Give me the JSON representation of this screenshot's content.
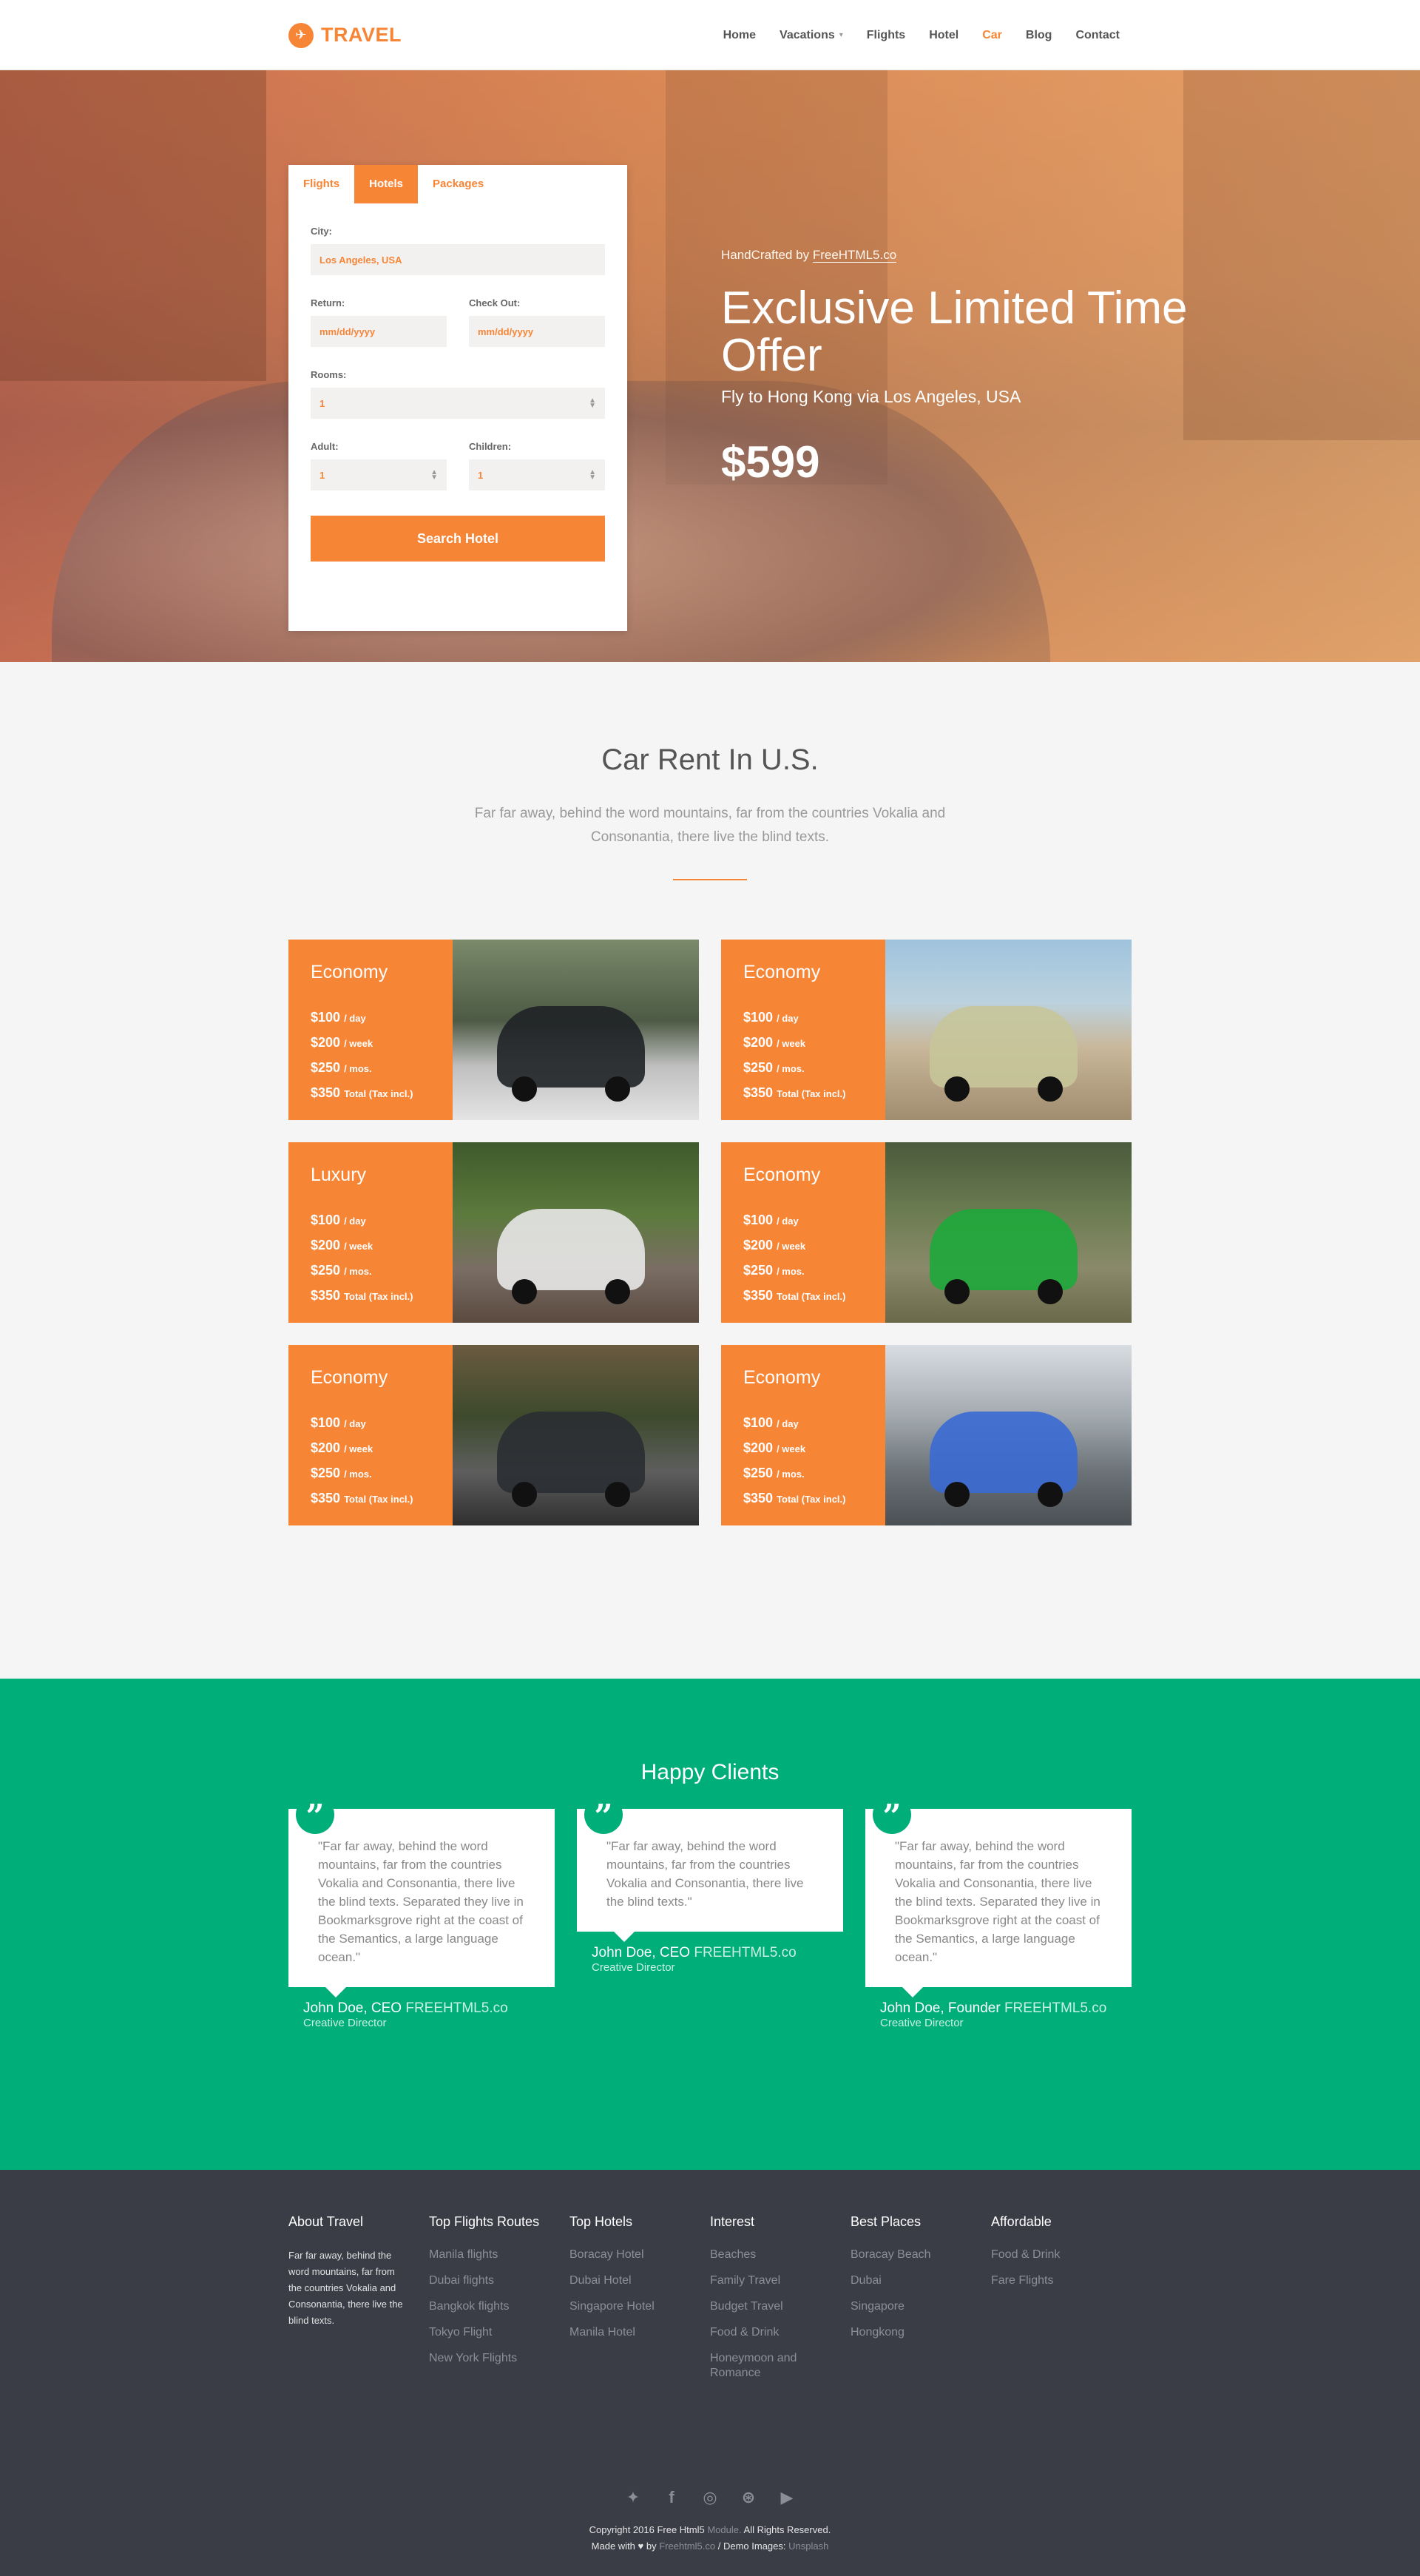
{
  "header": {
    "brand": "TRAVEL",
    "nav": [
      {
        "label": "Home",
        "active": false,
        "dropdown": false
      },
      {
        "label": "Vacations",
        "active": false,
        "dropdown": true
      },
      {
        "label": "Flights",
        "active": false,
        "dropdown": false
      },
      {
        "label": "Hotel",
        "active": false,
        "dropdown": false
      },
      {
        "label": "Car",
        "active": true,
        "dropdown": false
      },
      {
        "label": "Blog",
        "active": false,
        "dropdown": false
      },
      {
        "label": "Contact",
        "active": false,
        "dropdown": false
      }
    ]
  },
  "search": {
    "tabs": [
      "Flights",
      "Hotels",
      "Packages"
    ],
    "active_tab": "Hotels",
    "city_label": "City:",
    "city_value": "Los Angeles, USA",
    "return_label": "Return:",
    "return_value": "mm/dd/yyyy",
    "checkout_label": "Check Out:",
    "checkout_value": "mm/dd/yyyy",
    "rooms_label": "Rooms:",
    "rooms_value": "1",
    "adult_label": "Adult:",
    "adult_value": "1",
    "children_label": "Children:",
    "children_value": "1",
    "button": "Search Hotel"
  },
  "hero": {
    "handcrafted_prefix": "HandCrafted by",
    "handcrafted_link": "FreeHTML5.co",
    "title": "Exclusive Limited Time Offer",
    "subtitle": "Fly to Hong Kong via Los Angeles, USA",
    "price": "$599"
  },
  "rent": {
    "title": "Car Rent In U.S.",
    "description": "Far far away, behind the word mountains, far from the countries Vokalia and Consonantia, there live the blind texts.",
    "cards": [
      {
        "type": "Economy",
        "prices": [
          {
            "amount": "$100",
            "unit": "/ day"
          },
          {
            "amount": "$200",
            "unit": "/ week"
          },
          {
            "amount": "$250",
            "unit": "/ mos."
          },
          {
            "amount": "$350",
            "unit": "Total (Tax incl.)"
          }
        ]
      },
      {
        "type": "Economy",
        "prices": [
          {
            "amount": "$100",
            "unit": "/ day"
          },
          {
            "amount": "$200",
            "unit": "/ week"
          },
          {
            "amount": "$250",
            "unit": "/ mos."
          },
          {
            "amount": "$350",
            "unit": "Total (Tax incl.)"
          }
        ]
      },
      {
        "type": "Luxury",
        "prices": [
          {
            "amount": "$100",
            "unit": "/ day"
          },
          {
            "amount": "$200",
            "unit": "/ week"
          },
          {
            "amount": "$250",
            "unit": "/ mos."
          },
          {
            "amount": "$350",
            "unit": "Total (Tax incl.)"
          }
        ]
      },
      {
        "type": "Economy",
        "prices": [
          {
            "amount": "$100",
            "unit": "/ day"
          },
          {
            "amount": "$200",
            "unit": "/ week"
          },
          {
            "amount": "$250",
            "unit": "/ mos."
          },
          {
            "amount": "$350",
            "unit": "Total (Tax incl.)"
          }
        ]
      },
      {
        "type": "Economy",
        "prices": [
          {
            "amount": "$100",
            "unit": "/ day"
          },
          {
            "amount": "$200",
            "unit": "/ week"
          },
          {
            "amount": "$250",
            "unit": "/ mos."
          },
          {
            "amount": "$350",
            "unit": "Total (Tax incl.)"
          }
        ]
      },
      {
        "type": "Economy",
        "prices": [
          {
            "amount": "$100",
            "unit": "/ day"
          },
          {
            "amount": "$200",
            "unit": "/ week"
          },
          {
            "amount": "$250",
            "unit": "/ mos."
          },
          {
            "amount": "$350",
            "unit": "Total (Tax incl.)"
          }
        ]
      }
    ]
  },
  "clients": {
    "title": "Happy Clients",
    "items": [
      {
        "quote": "\"Far far away, behind the word mountains, far from the countries Vokalia and Consonantia, there live the blind texts. Separated they live in Bookmarksgrove right at the coast of the Semantics, a large language ocean.\"",
        "name": "John Doe, CEO",
        "company": "FREEHTML5.co",
        "role": "Creative Director"
      },
      {
        "quote": "\"Far far away, behind the word mountains, far from the countries Vokalia and Consonantia, there live the blind texts.\"",
        "name": "John Doe, CEO",
        "company": "FREEHTML5.co",
        "role": "Creative Director"
      },
      {
        "quote": "\"Far far away, behind the word mountains, far from the countries Vokalia and Consonantia, there live the blind texts. Separated they live in Bookmarksgrove right at the coast of the Semantics, a large language ocean.\"",
        "name": "John Doe, Founder",
        "company": "FREEHTML5.co",
        "role": "Creative Director"
      }
    ]
  },
  "footer": {
    "about_title": "About Travel",
    "about_text": "Far far away, behind the word mountains, far from the countries Vokalia and Consonantia, there live the blind texts.",
    "columns": [
      {
        "title": "Top Flights Routes",
        "links": [
          "Manila flights",
          "Dubai flights",
          "Bangkok flights",
          "Tokyo Flight",
          "New York Flights"
        ]
      },
      {
        "title": "Top Hotels",
        "links": [
          "Boracay Hotel",
          "Dubai Hotel",
          "Singapore Hotel",
          "Manila Hotel"
        ]
      },
      {
        "title": "Interest",
        "links": [
          "Beaches",
          "Family Travel",
          "Budget Travel",
          "Food & Drink",
          "Honeymoon and Romance"
        ]
      },
      {
        "title": "Best Places",
        "links": [
          "Boracay Beach",
          "Dubai",
          "Singapore",
          "Hongkong"
        ]
      },
      {
        "title": "Affordable",
        "links": [
          "Food & Drink",
          "Fare Flights"
        ]
      }
    ],
    "social_icons": [
      "twitter-icon",
      "facebook-icon",
      "instagram-icon",
      "dribbble-icon",
      "youtube-icon"
    ],
    "copyright": "Copyright 2016 Free Html5",
    "copyright_module": "Module.",
    "rights": "All Rights Reserved.",
    "made_with": "Made with",
    "by": "by",
    "by_link": "Freehtml5.co",
    "demo_images": "/ Demo Images:",
    "demo_link": "Unsplash"
  },
  "colors": {
    "accent": "#f78536",
    "green": "#00ae7a",
    "footer": "#3b3d46"
  }
}
